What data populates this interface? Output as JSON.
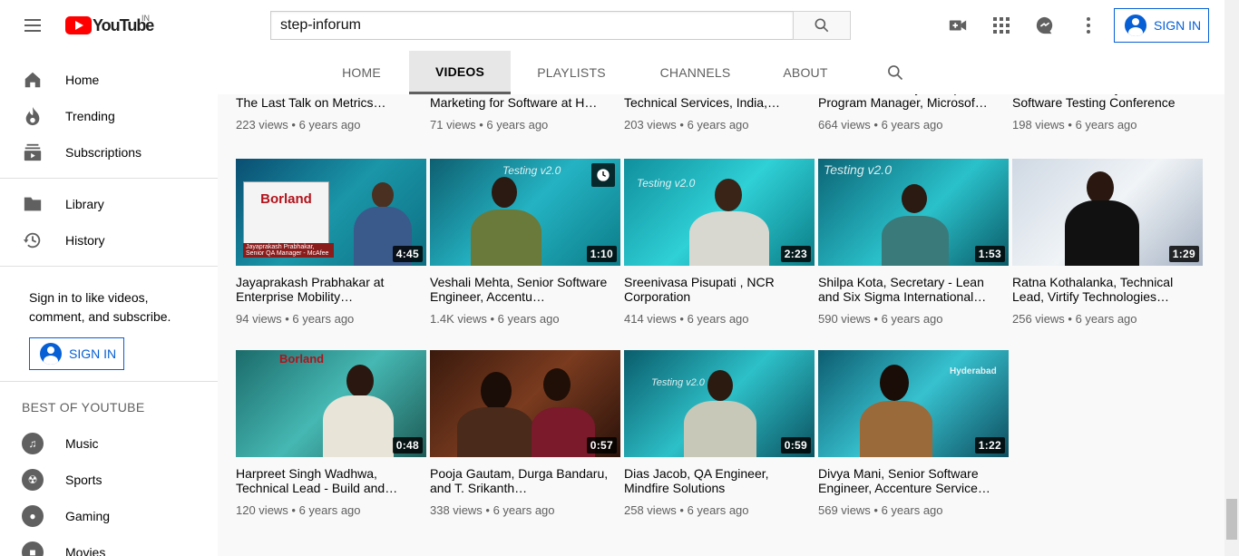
{
  "header": {
    "logo_text": "YouTube",
    "logo_country": "IN",
    "search_value": "step-inforum",
    "search_placeholder": "Search",
    "signin_label": "SIGN IN"
  },
  "sidebar": {
    "main": [
      {
        "label": "Home",
        "icon": "home-icon"
      },
      {
        "label": "Trending",
        "icon": "trending-icon"
      },
      {
        "label": "Subscriptions",
        "icon": "subscriptions-icon"
      }
    ],
    "library": [
      {
        "label": "Library",
        "icon": "library-icon"
      },
      {
        "label": "History",
        "icon": "history-icon"
      }
    ],
    "signin_prompt": "Sign in to like videos, comment, and subscribe.",
    "signin_label": "SIGN IN",
    "best_heading": "BEST OF YOUTUBE",
    "best": [
      {
        "label": "Music",
        "icon": "music-icon"
      },
      {
        "label": "Sports",
        "icon": "sports-icon"
      },
      {
        "label": "Gaming",
        "icon": "gaming-icon"
      },
      {
        "label": "Movies",
        "icon": "movies-icon"
      }
    ]
  },
  "tabs": [
    {
      "label": "HOME"
    },
    {
      "label": "VIDEOS",
      "active": true
    },
    {
      "label": "PLAYLISTS"
    },
    {
      "label": "CHANNELS"
    },
    {
      "label": "ABOUT"
    }
  ],
  "videos_row0": [
    {
      "title": "The Last Talk on Metrics…",
      "meta": "223 views • 6 years ago"
    },
    {
      "title": "Marketing for Software at H…",
      "meta": "71 views • 6 years ago"
    },
    {
      "title": "Technical Services, India,…",
      "meta": "203 views • 6 years ago"
    },
    {
      "title": "Program Manager, Microsof…",
      "meta": "664 views • 6 years ago"
    },
    {
      "title": "Software Testing Conference",
      "meta": "198 views • 6 years ago"
    }
  ],
  "videos_row1": [
    {
      "title": "Jayaprakash Prabhakar at Enterprise Mobility…",
      "meta": "94 views • 6 years ago",
      "duration": "4:45"
    },
    {
      "title": "Veshali Mehta, Senior Software Engineer, Accentu…",
      "meta": "1.4K views • 6 years ago",
      "duration": "1:10"
    },
    {
      "title": "Sreenivasa Pisupati , NCR Corporation",
      "meta": "414 views • 6 years ago",
      "duration": "2:23"
    },
    {
      "title": "Shilpa Kota, Secretary - Lean and Six Sigma International…",
      "meta": "590 views • 6 years ago",
      "duration": "1:53"
    },
    {
      "title": "Ratna Kothalanka, Technical Lead, Virtify Technologies…",
      "meta": "256 views • 6 years ago",
      "duration": "1:29"
    }
  ],
  "videos_row2": [
    {
      "title": "Harpreet Singh Wadhwa, Technical Lead - Build and…",
      "meta": "120 views • 6 years ago",
      "duration": "0:48"
    },
    {
      "title": "Pooja Gautam, Durga Bandaru, and T. Srikanth…",
      "meta": "338 views • 6 years ago",
      "duration": "0:57"
    },
    {
      "title": "Dias Jacob, QA Engineer, Mindfire Solutions",
      "meta": "258 views • 6 years ago",
      "duration": "0:59"
    },
    {
      "title": "Divya Mani, Senior Software Engineer, Accenture Service…",
      "meta": "569 views • 6 years ago",
      "duration": "1:22"
    }
  ],
  "thumb_texts": {
    "borland": "Borland",
    "testing": "Testing v2.0",
    "caption1": "Jayaprakash Prabhakar, Senior QA Manager - McAfee",
    "hyderabad": "Hyderabad"
  },
  "colors": {
    "accent": "#065fd4",
    "brand_red": "#ff0000"
  }
}
